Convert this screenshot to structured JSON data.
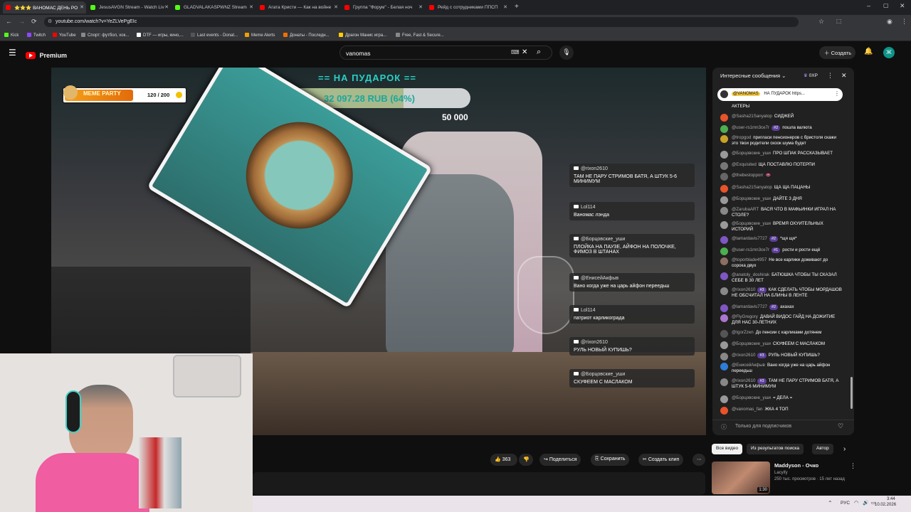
{
  "tabs": [
    {
      "label": "⭐⭐⭐ ВАНОМАС ДЕНЬ РО",
      "color": "#ff0000",
      "active": true
    },
    {
      "label": "JesusAVGN Stream - Watch Liv",
      "color": "#53fc18"
    },
    {
      "label": "GLADVALAKASPWNZ Stream",
      "color": "#53fc18"
    },
    {
      "label": "Агата Кристи — Как на войне",
      "color": "#ff0000"
    },
    {
      "label": "Группа \"Форум\" - Белая ноч",
      "color": "#ff0000"
    },
    {
      "label": "Рейд с сотрудниками ППСП",
      "color": "#ff0000"
    }
  ],
  "address": {
    "url": "youtube.com/watch?v=YeZLVePgEIc"
  },
  "bookmarks": [
    {
      "label": "Kick",
      "color": "#53fc18"
    },
    {
      "label": "Twitch",
      "color": "#9146ff"
    },
    {
      "label": "YouTube",
      "color": "#ff0000"
    },
    {
      "label": "Спорт: футбол, хок...",
      "color": "#888888"
    },
    {
      "label": "DTF — игры, кино,...",
      "color": "#ffffff"
    },
    {
      "label": "Last events - Donat...",
      "color": "#555555"
    },
    {
      "label": "Meme Alerts",
      "color": "#f0a000"
    },
    {
      "label": "Донаты - Последн...",
      "color": "#f07000"
    },
    {
      "label": "Драгон Манис игра...",
      "color": "#ffcc00"
    },
    {
      "label": "Free, Fast & Secure...",
      "color": "#888888"
    }
  ],
  "header": {
    "brand": "Premium",
    "search_value": "vanomas",
    "create_label": "Создать",
    "avatar_letter": "Ж"
  },
  "overlay": {
    "meme_party": "MEME PARTY",
    "meme_count": "120 / 200",
    "goal_title": "== НА ПУДАРОК ==",
    "goal_amount": "32 097.28 RUB (64%)",
    "goal_progress": 0.64,
    "goal_target": "50 000"
  },
  "stream_chat": [
    {
      "user": "@rixon2610",
      "text": "ТАМ НЕ ПАРУ СТРИМОВ БАТЯ, А ШТУК 5-6 МИНИМУМ"
    },
    {
      "user": "Lol114",
      "text": "Ваномас лэнда"
    },
    {
      "user": "@Борцовские_уши",
      "text": "ПЛОЙКА НА ПАУЗЕ, АЙФОН НА ПОЛОЧКЕ, ФИМОЗ В ШТАНАХ"
    },
    {
      "user": "@ЕнисейАкфыв",
      "text": "Вано когда уже на царь айфон переедьш"
    },
    {
      "user": "Lol114",
      "text": "патриот карликограда"
    },
    {
      "user": "@rixon2610",
      "text": "РУЛЬ НОВЫЙ КУПИШЬ?"
    },
    {
      "user": "@Борцовские_уши",
      "text": "СКУФЕЕМ С МАСЛАКОМ"
    }
  ],
  "livechat": {
    "title": "Интересные сообщения",
    "xp": "0XP",
    "pinned_user": "@VANOMAS",
    "pinned_text": "НА ПУДАРОК https...",
    "subscribers_only": "Только для подписчиков",
    "messages": [
      {
        "user": "",
        "badge": "",
        "text": "АКТЕРЫ",
        "color": "#888888"
      },
      {
        "user": "@Sasha21Sanyatop",
        "badge": "",
        "text": "СИДЖЕЙ",
        "color": "#e8532a"
      },
      {
        "user": "@user-rs1mn3ce7r",
        "badge": "#2",
        "text": "пошла валюта",
        "color": "#4caf50"
      },
      {
        "user": "@tropgod",
        "badge": "",
        "text": "пригласи пенсионеров с бристоля скажи это твои родители скоок шума будет",
        "color": "#c9a227"
      },
      {
        "user": "@Борцовские_уши",
        "badge": "",
        "text": "ПРО ШПАК РАССКАЗЫВАЕТ",
        "color": "#999999"
      },
      {
        "user": "@Exquisited",
        "badge": "",
        "text": "ЩА ПОСТАВЛЮ ПОТЕРПИ",
        "color": "#777777"
      },
      {
        "user": "@thebestopporr",
        "badge": "",
        "text": "👄",
        "color": "#666666"
      },
      {
        "user": "@Sasha21Sanyatop",
        "badge": "",
        "text": "ЩА ЩА ПАЦАНЫ",
        "color": "#e8532a"
      },
      {
        "user": "@Борцовские_уши",
        "badge": "",
        "text": "ДАЙТЕ 3 ДНЯ",
        "color": "#999999"
      },
      {
        "user": "@ZarubaART",
        "badge": "",
        "text": "ВАСЯ ЧТО В МАФЬИНКИ ИГРАЛ НА СТОЛЕ?",
        "color": "#888888"
      },
      {
        "user": "@Борцовские_уши",
        "badge": "",
        "text": "ВРЕМЯ ОХУИТЕЛЬНЫХ ИСТОРИЙ",
        "color": "#999999"
      },
      {
        "user": "@lamardavis7727",
        "badge": "#2",
        "text": "*щя щя*",
        "color": "#7e57c2"
      },
      {
        "user": "@user-rs1mn3ce7r",
        "badge": "#1",
        "text": "рости и рости ещё",
        "color": "#4caf50"
      },
      {
        "user": "@toporblade4957",
        "badge": "",
        "text": "Не все карлики доживают до сорока двух",
        "color": "#8d6e63"
      },
      {
        "user": "@anatoly_doshirak",
        "badge": "",
        "text": "БАТЮШКА ЧТОБЫ ТЫ СКАЗАЛ СЕБЕ В 30 ЛЕТ",
        "color": "#7e57c2"
      },
      {
        "user": "@rixon2610",
        "badge": "#3",
        "text": "КАК СДЕЛАТЬ ЧТОБЫ МОРДАШОВ НЕ ОБСЧИТАЛ НА БЛИНЫ В ЛЕНТЕ",
        "color": "#888888"
      },
      {
        "user": "@lamardavis7727",
        "badge": "#2",
        "text": "ахахах",
        "color": "#7e57c2"
      },
      {
        "user": "@FlyGregory",
        "badge": "",
        "text": "ДАВАЙ ВИДОС ГАЙД НА ДОЖИТИЕ ДЛЯ НАС 30-ЛЕТНИХ",
        "color": "#aa77cc"
      },
      {
        "user": "@IgorZzen",
        "badge": "",
        "text": "До пенсии с карликами дотянем",
        "color": "#555555"
      },
      {
        "user": "@Борцовские_уши",
        "badge": "",
        "text": "СКУФЕЕМ С МАСЛАКОМ",
        "color": "#999999"
      },
      {
        "user": "@rixon2610",
        "badge": "#3",
        "text": "РУЛЬ НОВЫЙ КУПИШЬ?",
        "color": "#888888"
      },
      {
        "user": "@ЕнисейАкфыв",
        "badge": "",
        "text": "Вано когда уже на царь айфон переедьш",
        "color": "#2e7dd7"
      },
      {
        "user": "@rixon2610",
        "badge": "#3",
        "text": "ТАМ НЕ ПАРУ СТРИМОВ БАТЯ, А ШТУК 5-6 МИНИМУМ",
        "color": "#888888"
      },
      {
        "user": "@Борцовские_уши",
        "badge": "",
        "text": "= ДЕЛА =",
        "color": "#999999"
      },
      {
        "user": "@vanomas_fan",
        "badge": "",
        "text": "ЖКА 4 ТОП",
        "color": "#e8532a"
      }
    ]
  },
  "actions": {
    "likes": "363",
    "share": "Поделиться",
    "save": "Сохранить",
    "clip": "Создать клип"
  },
  "related": {
    "chips": [
      "Все видео",
      "Из результатов поиска",
      "Автор"
    ],
    "video": {
      "title": "Maddyson - Очко",
      "channel": "Lacyify",
      "meta": "250 тыс. просмотров · 15 лет назад",
      "duration": "1:30"
    }
  },
  "taskbar": {
    "lang": "РУС",
    "time": "3:44",
    "date": "10.02.2026"
  }
}
